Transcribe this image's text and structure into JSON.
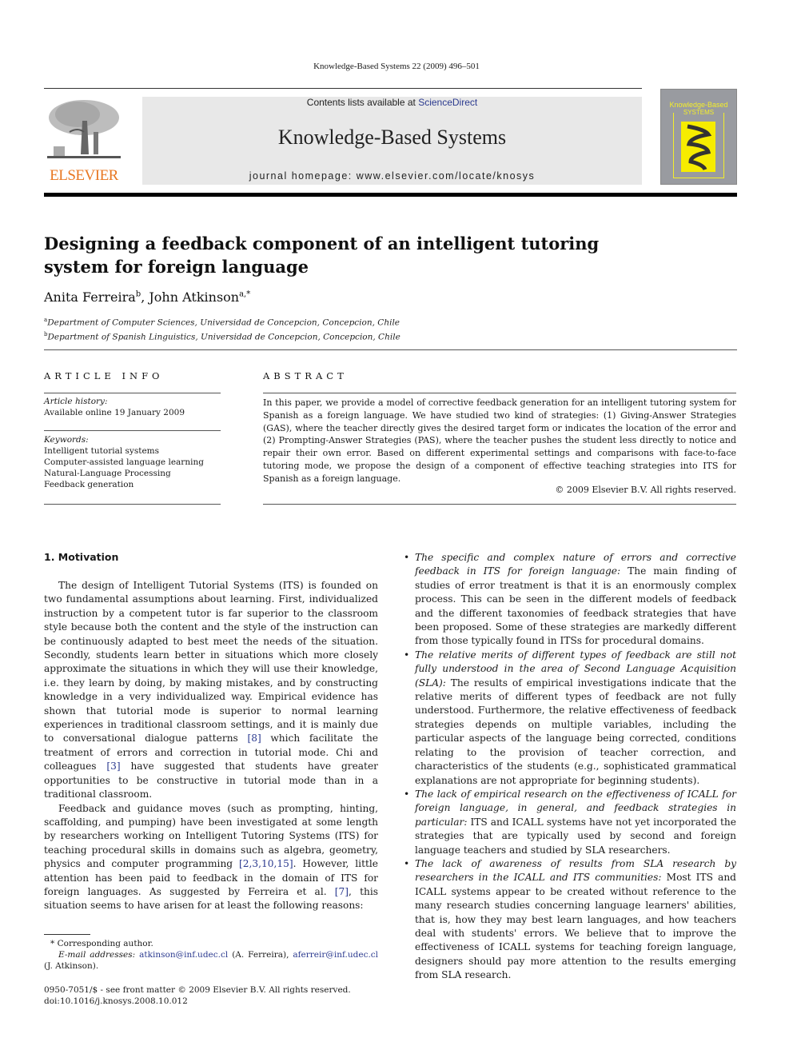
{
  "running_head": "Knowledge-Based Systems 22 (2009) 496–501",
  "banner": {
    "contents_prefix": "Contents lists available at ",
    "contents_link": "ScienceDirect",
    "journal_name": "Knowledge-Based Systems",
    "homepage": "journal homepage: www.elsevier.com/locate/knosys"
  },
  "publisher_logo": {
    "wordmark": "ELSEVIER",
    "color": "#e87722"
  },
  "cover": {
    "title_line1": "Knowledge-Based",
    "title_line2": "SYSTEMS",
    "accent": "#f4ee2a"
  },
  "article": {
    "title": "Designing a feedback component of an intelligent tutoring system for foreign language",
    "authors": [
      {
        "name": "Anita Ferreira",
        "sup": "b"
      },
      {
        "name": "John Atkinson",
        "sup": "a,*"
      }
    ],
    "affiliations": [
      {
        "sup": "a",
        "text": "Department of Computer Sciences, Universidad de Concepcion, Concepcion, Chile"
      },
      {
        "sup": "b",
        "text": "Department of Spanish Linguistics, Universidad de Concepcion, Concepcion, Chile"
      }
    ]
  },
  "article_info": {
    "label": "ARTICLE INFO",
    "history_label": "Article history:",
    "history_value": "Available online 19 January 2009",
    "keywords_label": "Keywords:",
    "keywords": [
      "Intelligent tutorial systems",
      "Computer-assisted language learning",
      "Natural-Language Processing",
      "Feedback generation"
    ]
  },
  "abstract": {
    "label": "ABSTRACT",
    "text": "In this paper, we provide a model of corrective feedback generation for an intelligent tutoring system for Spanish as a foreign language. We have studied two kind of strategies: (1) Giving-Answer Strategies (GAS), where the teacher directly gives the desired target form or indicates the location of the error and (2) Prompting-Answer Strategies (PAS), where the teacher pushes the student less directly to notice and repair their own error. Based on different experimental settings and comparisons with face-to-face tutoring mode, we propose the design of a component of effective teaching strategies into ITS for Spanish as a foreign language.",
    "copyright": "© 2009 Elsevier B.V. All rights reserved."
  },
  "section1": {
    "heading": "1. Motivation",
    "p1": [
      "The design of Intelligent Tutorial Systems (ITS) is founded on two fundamental assumptions about learning. First, individualized instruction by a competent tutor is far superior to the classroom style because both the content and the style of the instruction can be continuously adapted to best meet the needs of the situation. Secondly, students learn better in situations which more closely approximate the situations in which they will use their knowledge, i.e. they learn by doing, by making mistakes, and by constructing knowledge in a very individualized way. Empirical evidence has shown that tutorial mode is superior to normal learning experiences in traditional classroom settings, and it is mainly due to conversational dialogue patterns ",
      "[8]",
      " which facilitate the treatment of errors and correction in tutorial mode. Chi and colleagues ",
      "[3]",
      " have suggested that students have greater opportunities to be constructive in tutorial mode than in a traditional classroom."
    ],
    "p2": [
      "Feedback and guidance moves (such as prompting, hinting, scaffolding, and pumping) have been investigated at some length by researchers working on Intelligent Tutoring Systems (ITS) for teaching procedural skills in domains such as algebra, geometry, physics and computer programming ",
      "[2,3,10,15]",
      ". However, little attention has been paid to feedback in the domain of ITS for foreign languages. As suggested by Ferreira et al. ",
      "[7]",
      ", this situation seems to have arisen for at least the following reasons:"
    ],
    "bullets": [
      {
        "lead": "The specific and complex nature of errors and corrective feedback in ITS for foreign language:",
        "text": " The main finding of studies of error treatment is that it is an enormously complex process. This can be seen in the different models of feedback and the different taxonomies of feedback strategies that have been proposed. Some of these strategies are markedly different from those typically found in ITSs for procedural domains."
      },
      {
        "lead": "The relative merits of different types of feedback are still not fully understood in the area of Second Language Acquisition (SLA):",
        "text": " The results of empirical investigations indicate that the relative merits of different types of feedback are not fully understood. Furthermore, the relative effectiveness of feedback strategies depends on multiple variables, including the particular aspects of the language being corrected, conditions relating to the provision of teacher correction, and characteristics of the students (e.g., sophisticated grammatical explanations are not appropriate for beginning students)."
      },
      {
        "lead": "The lack of empirical research on the effectiveness of ICALL for foreign language, in general, and feedback strategies in particular:",
        "text": " ITS and ICALL systems have not yet incorporated the strategies that are typically used by second and foreign language teachers and studied by SLA researchers."
      },
      {
        "lead": "The lack of awareness of results from SLA research by researchers in the ICALL and ITS communities:",
        "text": " Most ITS and ICALL systems appear to be created without reference to the many research studies concerning language learners' abilities, that is, how they may best learn languages, and how teachers deal with students' errors. We believe that to improve the effectiveness of ICALL systems for teaching foreign language, designers should pay more attention to the results emerging from SLA research."
      }
    ]
  },
  "footnote": {
    "corresponding": "* Corresponding author.",
    "email_label": "E-mail addresses:",
    "email1": "atkinson@inf.udec.cl",
    "email1_owner": " (A. Ferreira), ",
    "email2": "aferreir@inf.udec.cl",
    "email2_owner": " (J. Atkinson)."
  },
  "front_matter": {
    "issn_line": "0950-7051/$ - see front matter © 2009 Elsevier B.V. All rights reserved.",
    "doi": "doi:10.1016/j.knosys.2008.10.012"
  }
}
